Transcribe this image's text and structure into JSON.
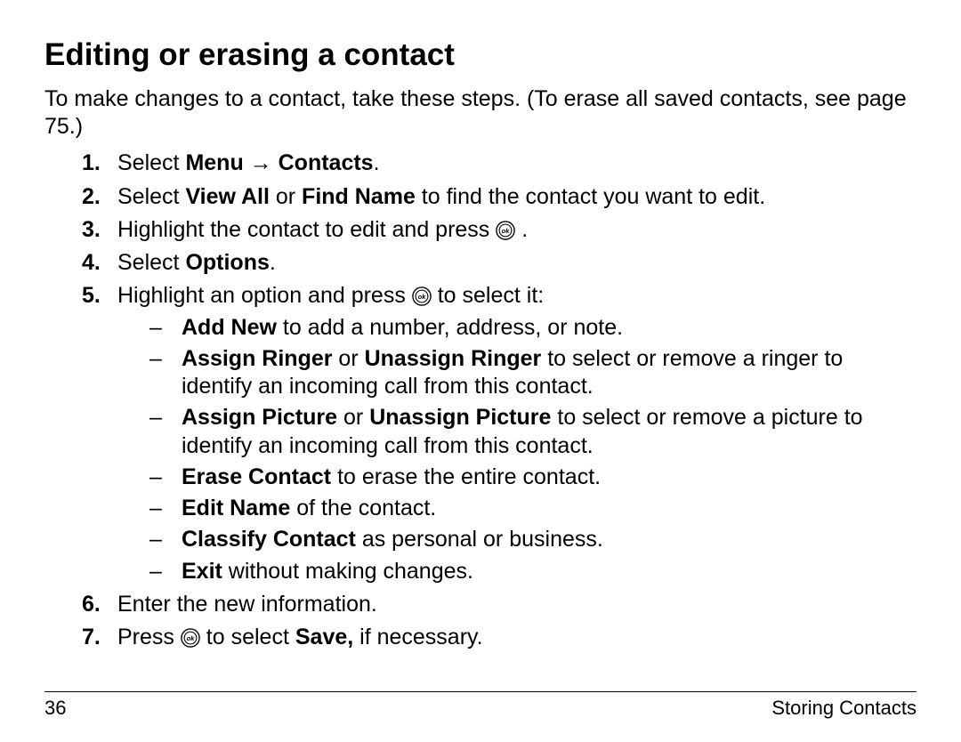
{
  "title": "Editing or erasing a contact",
  "intro": "To make changes to a contact, take these steps. (To erase all saved contacts, see page 75.)",
  "steps": {
    "s1": {
      "num": "1.",
      "t1": "Select ",
      "b1": "Menu",
      "arrow": " → ",
      "b2": "Contacts",
      "t2": "."
    },
    "s2": {
      "num": "2.",
      "t1": "Select ",
      "b1": "View All",
      "t2": " or ",
      "b2": "Find Name",
      "t3": " to find the contact you want to edit."
    },
    "s3": {
      "num": "3.",
      "t1": "Highlight the contact to edit and press ",
      "t2": " ."
    },
    "s4": {
      "num": "4.",
      "t1": "Select ",
      "b1": "Options",
      "t2": "."
    },
    "s5": {
      "num": "5.",
      "t1": "Highlight an option and press ",
      "t2": "  to select it:"
    },
    "s6": {
      "num": "6.",
      "t1": "Enter the new information."
    },
    "s7": {
      "num": "7.",
      "t1": "Press ",
      "t2": "  to select ",
      "b1": "Save,",
      "t3": " if necessary."
    }
  },
  "sub": {
    "a": {
      "b1": "Add New",
      "t1": " to add a number, address, or note."
    },
    "b": {
      "b1": "Assign Ringer",
      "t1": " or ",
      "b2": "Unassign Ringer",
      "t2": " to select or remove a ringer to identify an incoming call from this contact."
    },
    "c": {
      "b1": "Assign Picture",
      "t1": " or ",
      "b2": "Unassign Picture",
      "t2": " to select or remove a picture to identify an incoming call from this contact."
    },
    "d": {
      "b1": "Erase Contact",
      "t1": " to erase the entire contact."
    },
    "e": {
      "b1": "Edit Name",
      "t1": " of the contact."
    },
    "f": {
      "b1": "Classify Contact",
      "t1": " as personal or business."
    },
    "g": {
      "b1": "Exit",
      "t1": " without making changes."
    }
  },
  "footer": {
    "page": "36",
    "section": "Storing Contacts"
  },
  "icons": {
    "ok": "ok-button"
  }
}
